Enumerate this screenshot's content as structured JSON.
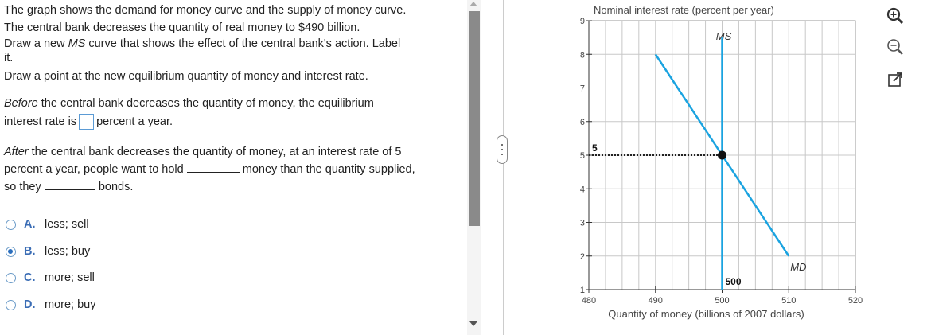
{
  "question": {
    "line1": "The graph shows the demand for money curve and the supply of money curve.",
    "line2": "The central bank decreases the quantity of real money to $490 billion.",
    "line3a": "Draw a new ",
    "line3b": "MS",
    "line3c": " curve that shows the effect of the  central bank's action. Label",
    "line3d": "it.",
    "line4": "Draw a point at the new equilibrium quantity of money and interest rate.",
    "q1a": "Before",
    "q1b": " the central bank decreases the quantity of money, the equilibrium",
    "q1c": "interest rate is",
    "q1d": "percent a year.",
    "q2a": "After",
    "q2b": " the central bank decreases the quantity of money, at an interest rate of 5",
    "q2c": "percent a year, people want to hold",
    "q2d": "money than the quantity supplied,",
    "q2e": "so they",
    "q2f": "bonds."
  },
  "options": [
    {
      "letter": "A.",
      "text": "less; sell",
      "selected": false
    },
    {
      "letter": "B.",
      "text": "less; buy",
      "selected": true
    },
    {
      "letter": "C.",
      "text": "more; sell",
      "selected": false
    },
    {
      "letter": "D.",
      "text": "more; buy",
      "selected": false
    }
  ],
  "tools": {
    "zoom_in": "zoom-in-icon",
    "zoom_out": "zoom-out-icon",
    "popout": "popout-icon"
  },
  "chart_data": {
    "type": "line",
    "ylabel": "Nominal interest rate (percent per year)",
    "xlabel": "Quantity of money (billions of 2007 dollars)",
    "xlim": [
      480,
      520
    ],
    "ylim": [
      1,
      9
    ],
    "xticks": [
      480,
      490,
      500,
      510,
      520
    ],
    "yticks": [
      1,
      2,
      3,
      4,
      5,
      6,
      7,
      8,
      9
    ],
    "grid": true,
    "series": [
      {
        "name": "MD",
        "x": [
          490,
          510
        ],
        "y": [
          8,
          2
        ],
        "color": "#1aa3e0"
      },
      {
        "name": "MS",
        "x": [
          500,
          500
        ],
        "y": [
          1,
          8.5
        ],
        "color": "#1aa3e0"
      }
    ],
    "equilibrium": {
      "x": 500,
      "y": 5
    },
    "point_labels": {
      "x_value": "500",
      "y_value": "5"
    }
  }
}
